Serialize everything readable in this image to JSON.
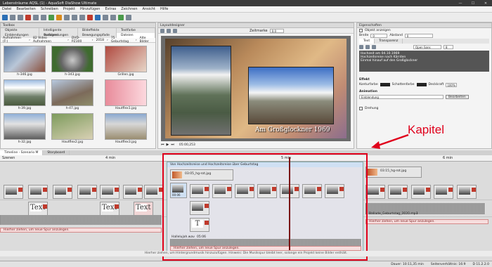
{
  "window": {
    "title": "Lebensträume AQSL (1) - AquaSoft DiaShow Ultimate",
    "controls": [
      "—",
      "☐",
      "✕"
    ]
  },
  "menu": [
    "Datei",
    "Bearbeiten",
    "Schreiben",
    "Projekt",
    "Hinzufügen",
    "Extras",
    "Zeichnen",
    "Ansicht",
    "Hilfe"
  ],
  "toolbox": {
    "title": "Toolbox",
    "tabs_row1": [
      "Objekte",
      "Intelligente Vorlagen",
      "Bildeffekte",
      "Textfarbe"
    ],
    "tabs_row2": [
      "Einblendungen",
      "Ausblendungen",
      "Bewegungspfade",
      "Dateien"
    ],
    "breadcrumb": [
      "Aufnahmen (F:)",
      "82 Video Aufnahmen",
      "DVD-PZ300",
      "2018",
      "75 Geburtstag",
      "Alte Bilder"
    ],
    "thumbs": [
      {
        "caption": "h-346.jpg"
      },
      {
        "caption": "h-343.jpg"
      },
      {
        "caption": "Grillen.jpg"
      },
      {
        "caption": "h-39.jpg"
      },
      {
        "caption": "h-47.jpg"
      },
      {
        "caption": "Hautflex1.jpg"
      },
      {
        "caption": "h-32.jpg"
      },
      {
        "caption": "Hautflex2.jpg"
      },
      {
        "caption": "Hautflex3.jpg"
      }
    ]
  },
  "layout": {
    "title": "Layoutdesigner",
    "zoom_label": "Zeitmarke",
    "zoom_value": "0.0",
    "slide_caption": "Am Großglockner 1969",
    "time": "05:00,253"
  },
  "properties": {
    "title": "Eigenschaften",
    "show_object_label": "Objekt anzeigen",
    "width_label": "Breite",
    "width_value": "0",
    "distance_label": "Abstand",
    "distance_value": "0",
    "text_tab": "Text",
    "transparency_tab": "Transparenz",
    "font": "Open Sans",
    "font_size": "8",
    "lines": [
      "Hochzeit am 04.10.1969",
      "Hochzeitsreise nach Kärnten",
      "Einmal hinauf auf den Großglockner"
    ],
    "effect_label": "Effekt",
    "contour_label": "Konturfarbe",
    "shadow_label": "Schattenfarbe",
    "opacity_label": "Deckkraft",
    "opacity_value": "100%",
    "animation_label": "Animation",
    "animation_value": "Einblendung",
    "edit_button": "Bearbeiten",
    "rotate_label": "Drehung"
  },
  "annotation": {
    "label": "Kapitel",
    "color": "#e0001b"
  },
  "timeline": {
    "tabs": [
      "Timeline - Szenario M",
      "Storyboard"
    ],
    "track_label": "Szenen",
    "ruler_marks": [
      "4 min",
      "5 min",
      "6 min"
    ],
    "chapter_title": "Von Hochzeitsreise und Hochzeitsreise über Geburtstag",
    "chapter_clip": "03:05_hg-rot.jpg",
    "next_clip": "03:15_hg-rot.jpg",
    "clip_times": [
      "00:06",
      "00:06",
      "00:06",
      "00:06"
    ],
    "hint_left": "Hierher ziehen, um neue Spur anzulegen.",
    "hint_mid": "Hierher ziehen, um neue Spur anzulegen.",
    "hint_right": "Hierher ziehen, um neue Spur anzulegen.",
    "audio_label": "Hallelujah.wav",
    "audio_time": "05:06",
    "audio_right": "Ballade_Geburtstag_2020.mp3",
    "footer": "Hierher ziehen, um Hintergrundmusik hinzuzufügen. Hinweis: Die Musikspur bleibt leer, solange ein Projekt keine Bilder enthält.",
    "tooltip_text": "Alte Bilder",
    "t_labels": [
      "Text",
      "Text",
      "Text"
    ]
  },
  "status": {
    "duration": "Dauer: 10:11,35 min",
    "resolution": "Seitenverhältnis: 16:9",
    "version": "D 11.2.2.0"
  }
}
